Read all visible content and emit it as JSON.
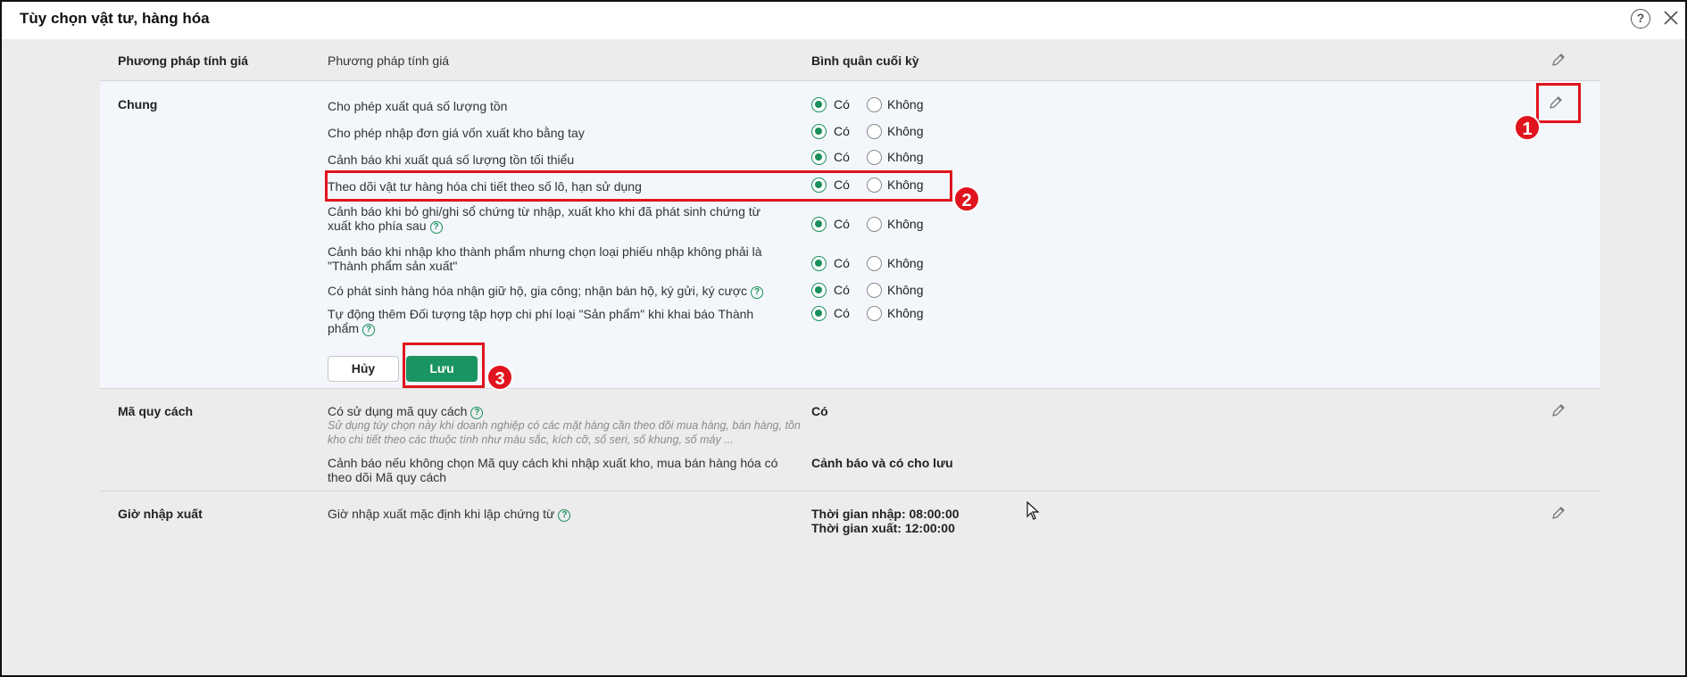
{
  "window": {
    "title": "Tùy chọn vật tư, hàng hóa"
  },
  "icons": {
    "help": "help-circle-icon",
    "close": "close-icon",
    "edit": "pencil-icon",
    "info": "question-circle-icon"
  },
  "colors": {
    "accent": "#1a9460",
    "highlight": "#e0141e",
    "active_bg": "#f3f7fb"
  },
  "sections": {
    "pricing": {
      "label": "Phương pháp tính giá",
      "description": "Phương pháp tính giá",
      "value": "Bình quân cuối kỳ"
    },
    "general": {
      "label": "Chung",
      "options": [
        {
          "text": "Cho phép xuất quá số lượng tồn",
          "yes": "Có",
          "no": "Không",
          "selected": "Có"
        },
        {
          "text": "Cho phép nhập đơn giá vốn xuất kho bằng tay",
          "yes": "Có",
          "no": "Không",
          "selected": "Có"
        },
        {
          "text": "Cảnh báo khi xuất quá số lượng tồn tối thiểu",
          "yes": "Có",
          "no": "Không",
          "selected": "Có"
        },
        {
          "text": "Theo dõi vật tư hàng hóa chi tiết theo số lô, hạn sử dụng",
          "yes": "Có",
          "no": "Không",
          "selected": "Có"
        },
        {
          "text": "Cảnh báo khi bỏ ghi/ghi sổ chứng từ nhập, xuất kho khi đã phát sinh chứng từ xuất kho phía sau",
          "yes": "Có",
          "no": "Không",
          "selected": "Có"
        },
        {
          "text": "Cảnh báo khi nhập kho thành phẩm nhưng chọn loại phiếu nhập không phải là \"Thành phẩm sản xuất\"",
          "yes": "Có",
          "no": "Không",
          "selected": "Có"
        },
        {
          "text": "Có phát sinh hàng hóa nhận giữ hộ, gia công; nhận bán hộ, ký gửi, ký cược",
          "yes": "Có",
          "no": "Không",
          "selected": "Có"
        },
        {
          "text": "Tự động thêm Đối tượng tập hợp chi phí loại \"Sản phẩm\" khi khai báo Thành phẩm",
          "yes": "Có",
          "no": "Không",
          "selected": "Có"
        }
      ],
      "cancel_label": "Hủy",
      "save_label": "Lưu"
    },
    "spec_code": {
      "label": "Mã quy cách",
      "use_title": "Có sử dụng mã quy cách",
      "use_hint": "Sử dụng tùy chọn này khi doanh nghiệp có các mặt hàng cần theo dõi mua hàng, bán hàng, tồn kho chi tiết theo các thuộc tính như màu sắc, kích cỡ, số seri, số khung, số máy ...",
      "use_value": "Có",
      "warn_text": "Cảnh báo nếu không chọn Mã quy cách khi nhập xuất kho, mua bán hàng hóa có theo dõi Mã quy cách",
      "warn_value": "Cảnh báo và có cho lưu"
    },
    "io_time": {
      "label": "Giờ nhập xuất",
      "description": "Giờ nhập xuất mặc định khi lập chứng từ",
      "value_in": "Thời gian nhập: 08:00:00",
      "value_out": "Thời gian xuất: 12:00:00"
    }
  },
  "annotations": [
    "1",
    "2",
    "3"
  ]
}
